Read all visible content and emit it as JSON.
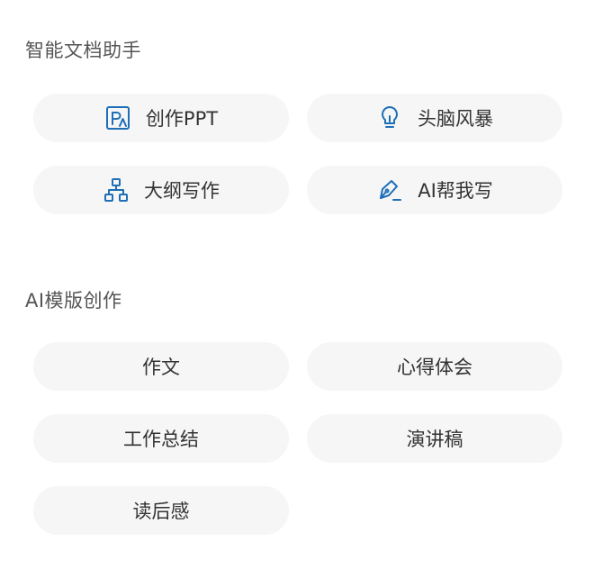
{
  "colors": {
    "icon_blue": "#1e6fb8",
    "pill_bg": "#f6f6f6",
    "text": "#333333",
    "title_text": "#555555"
  },
  "assistant": {
    "title": "智能文档助手",
    "items": [
      {
        "label": "创作PPT",
        "icon": "ppt-icon"
      },
      {
        "label": "头脑风暴",
        "icon": "lightbulb-icon"
      },
      {
        "label": "大纲写作",
        "icon": "outline-tree-icon"
      },
      {
        "label": "AI帮我写",
        "icon": "pen-write-icon"
      }
    ]
  },
  "templates": {
    "title": "AI模版创作",
    "items": [
      {
        "label": "作文"
      },
      {
        "label": "心得体会"
      },
      {
        "label": "工作总结"
      },
      {
        "label": "演讲稿"
      },
      {
        "label": "读后感"
      }
    ]
  }
}
